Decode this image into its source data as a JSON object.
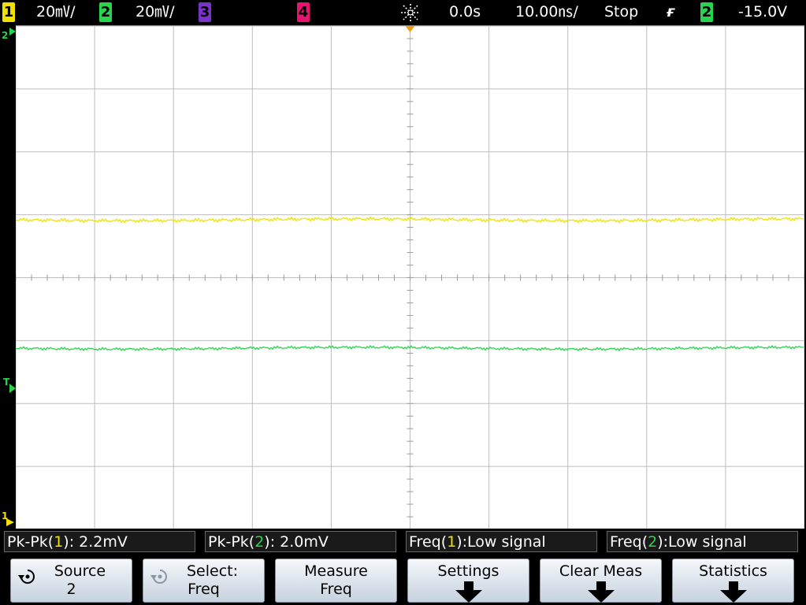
{
  "topbar": {
    "ch1": {
      "num": "1",
      "scale": "20㎷/",
      "color": "#f0e100"
    },
    "ch2": {
      "num": "2",
      "scale": "20㎷/",
      "color": "#27d44b"
    },
    "ch3": {
      "num": "3",
      "color": "#7a33c9"
    },
    "ch4": {
      "num": "4",
      "color": "#e8136f"
    },
    "delay": "0.0s",
    "timebase": "10.00㎱/",
    "run_state": "Stop",
    "trigger": {
      "slope": "ғ",
      "source": "2",
      "level": "-15.0V"
    }
  },
  "markers": {
    "ch2_ground": "2",
    "trigger_level": "T",
    "ch1_ground": "1"
  },
  "measurements": [
    {
      "prefix": "Pk-Pk(",
      "ch": "1",
      "suffix": "): 2.2mV",
      "color": "#f0e100"
    },
    {
      "prefix": "Pk-Pk(",
      "ch": "2",
      "suffix": "): 2.0mV",
      "color": "#27d44b"
    },
    {
      "prefix": "Freq(",
      "ch": "1",
      "suffix": "):Low signal",
      "color": "#f0e100"
    },
    {
      "prefix": "Freq(",
      "ch": "2",
      "suffix": "):Low signal",
      "color": "#27d44b"
    }
  ],
  "softkeys": {
    "source": {
      "line1": "Source",
      "line2": "2"
    },
    "select": {
      "line1": "Select:",
      "line2": "Freq"
    },
    "measure": {
      "line1": "Measure",
      "line2": "Freq"
    },
    "settings": {
      "line1": "Settings"
    },
    "clear": {
      "line1": "Clear Meas"
    },
    "statistics": {
      "line1": "Statistics"
    }
  }
}
